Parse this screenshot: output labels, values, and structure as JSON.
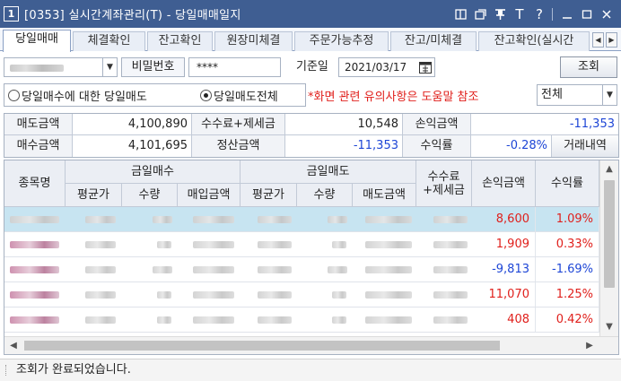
{
  "window": {
    "number_badge": "1",
    "title": "[0353] 실시간계좌관리(T) - 당일매매일지",
    "buttons": [
      "window-restore",
      "window-new",
      "pin",
      "T",
      "?",
      "minimize",
      "maximize",
      "close"
    ]
  },
  "tabs": [
    {
      "label": "당일매매",
      "active": true
    },
    {
      "label": "체결확인",
      "active": false
    },
    {
      "label": "잔고확인",
      "active": false
    },
    {
      "label": "원장미체결",
      "active": false
    },
    {
      "label": "주문가능추정",
      "active": false
    },
    {
      "label": "잔고/미체결",
      "active": false
    },
    {
      "label": "잔고확인(실시간",
      "active": false
    }
  ],
  "controls": {
    "password_label": "비밀번호",
    "password_value": "****",
    "date_label": "기준일",
    "date_value": "2021/03/17",
    "query_button": "조회",
    "radio_option_1": "당일매수에 대한 당일매도",
    "radio_option_2": "당일매도전체",
    "radio_selected": "당일매도전체",
    "notice": "*화면 관련 유의사항은 도움말 참조",
    "filter_value": "전체"
  },
  "summary": {
    "sell_amount_label": "매도금액",
    "sell_amount": "4,100,890",
    "fee_tax_label": "수수료+제세금",
    "fee_tax": "10,548",
    "pnl_label": "손익금액",
    "pnl": "-11,353",
    "buy_amount_label": "매수금액",
    "buy_amount": "4,101,695",
    "settle_label": "정산금액",
    "settle": "-11,353",
    "return_label": "수익률",
    "return": "-0.28%",
    "history_button": "거래내역"
  },
  "table": {
    "headers": {
      "stock": "종목명",
      "today_buy": "금일매수",
      "today_sell": "금일매도",
      "fee": "수수료\n+제세금",
      "pnl": "손익금액",
      "rate": "수익률",
      "buy_avg": "평균가",
      "buy_qty": "수량",
      "buy_amount": "매입금액",
      "sell_avg": "평균가",
      "sell_qty": "수량",
      "sell_amount": "매도금액"
    },
    "rows": [
      {
        "pnl": "8,600",
        "rate": "1.09%",
        "sign": "pos",
        "selected": true,
        "pink": false
      },
      {
        "pnl": "1,909",
        "rate": "0.33%",
        "sign": "pos",
        "selected": false,
        "pink": true
      },
      {
        "pnl": "-9,813",
        "rate": "-1.69%",
        "sign": "neg",
        "selected": false,
        "pink": true
      },
      {
        "pnl": "11,070",
        "rate": "1.25%",
        "sign": "pos",
        "selected": false,
        "pink": true
      },
      {
        "pnl": "408",
        "rate": "0.42%",
        "sign": "pos",
        "selected": false,
        "pink": true
      }
    ]
  },
  "status_text": "조회가 완료되었습니다."
}
